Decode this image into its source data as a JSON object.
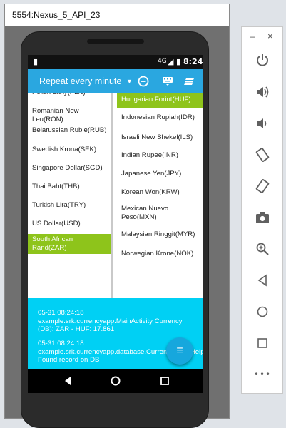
{
  "window": {
    "title": "5554:Nexus_5_API_23"
  },
  "status_bar": {
    "time": "8:24",
    "signal_label": "4G"
  },
  "app_bar": {
    "spinner_label": "Repeat every minute",
    "icons": [
      "remove-circle-icon",
      "keyboard-icon",
      "sort-icon"
    ]
  },
  "left_currencies": [
    {
      "label": "Polish Zloty(PLN)",
      "selected": false
    },
    {
      "label": "Romanian New Leu(RON)",
      "selected": false
    },
    {
      "label": "Belarussian Ruble(RUB)",
      "selected": false
    },
    {
      "label": "Swedish Krona(SEK)",
      "selected": false
    },
    {
      "label": "Singapore Dollar(SGD)",
      "selected": false
    },
    {
      "label": "Thai Baht(THB)",
      "selected": false
    },
    {
      "label": "Turkish Lira(TRY)",
      "selected": false
    },
    {
      "label": "US Dollar(USD)",
      "selected": false
    },
    {
      "label": "South African Rand(ZAR)",
      "selected": true
    }
  ],
  "right_currencies": [
    {
      "label": "Hungarian Forint(HUF)",
      "selected": true
    },
    {
      "label": "Indonesian Rupiah(IDR)",
      "selected": false
    },
    {
      "label": "Israeli New Shekel(ILS)",
      "selected": false
    },
    {
      "label": "Indian Rupee(INR)",
      "selected": false
    },
    {
      "label": "Japanese Yen(JPY)",
      "selected": false
    },
    {
      "label": "Korean Won(KRW)",
      "selected": false
    },
    {
      "label": "Mexican Nuevo Peso(MXN)",
      "selected": false
    },
    {
      "label": "Malaysian Ringgit(MYR)",
      "selected": false
    },
    {
      "label": "Norwegian Krone(NOK)",
      "selected": false
    }
  ],
  "log": {
    "entries": [
      "05-31 08:24:18 example.srk.currencyapp.MainActivity Currency (DB): ZAR - HUF: 17.861",
      "05-31 08:24:18 example.srk.currencyapp.database.CurrencyTableHelper Found record on DB"
    ]
  },
  "fab": {
    "icon": "menu-icon"
  },
  "nav_bar": {
    "buttons": [
      "back-icon",
      "home-icon",
      "recents-icon"
    ]
  },
  "side_toolbar": {
    "buttons": [
      "power-icon",
      "volume-up-icon",
      "volume-down-icon",
      "rotate-left-icon",
      "rotate-right-icon",
      "camera-icon",
      "zoom-icon",
      "back-icon",
      "home-icon",
      "overview-icon",
      "more-icon"
    ],
    "minimize_label": "–",
    "close_label": "×",
    "more_label": "•••"
  },
  "colors": {
    "app_bar": "#2aa7e0",
    "selected_item": "#8ec41b",
    "log_panel": "#00d0f4",
    "fab": "#16a7dd"
  }
}
